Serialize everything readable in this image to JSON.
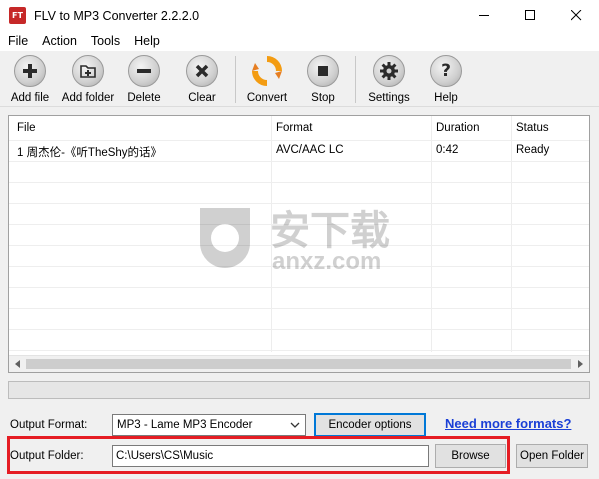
{
  "window": {
    "title": "FLV to MP3 Converter 2.2.2.0",
    "icon_text": "FT"
  },
  "menu": [
    "File",
    "Action",
    "Tools",
    "Help"
  ],
  "toolbar": {
    "add_file": "Add file",
    "add_folder": "Add folder",
    "delete": "Delete",
    "clear": "Clear",
    "convert": "Convert",
    "stop": "Stop",
    "settings": "Settings",
    "help": "Help"
  },
  "grid": {
    "columns": [
      "File",
      "Format",
      "Duration",
      "Status"
    ],
    "rows": [
      {
        "file": "1 周杰伦-《听TheShy的话》",
        "format": "AVC/AAC LC",
        "duration": "0:42",
        "status": "Ready"
      }
    ]
  },
  "watermark": {
    "cn": "安下载",
    "en": "anxz.com"
  },
  "output": {
    "format_label": "Output Format:",
    "format_value": "MP3 - Lame MP3 Encoder",
    "encoder_options": "Encoder options",
    "more_formats_link": "Need more formats?",
    "folder_label": "Output Folder:",
    "folder_value": "C:\\Users\\CS\\Music",
    "browse": "Browse",
    "open_folder": "Open Folder"
  },
  "colors": {
    "highlight_box": "#e51c23",
    "link": "#1a3fd6",
    "app_icon": "#c62828"
  }
}
